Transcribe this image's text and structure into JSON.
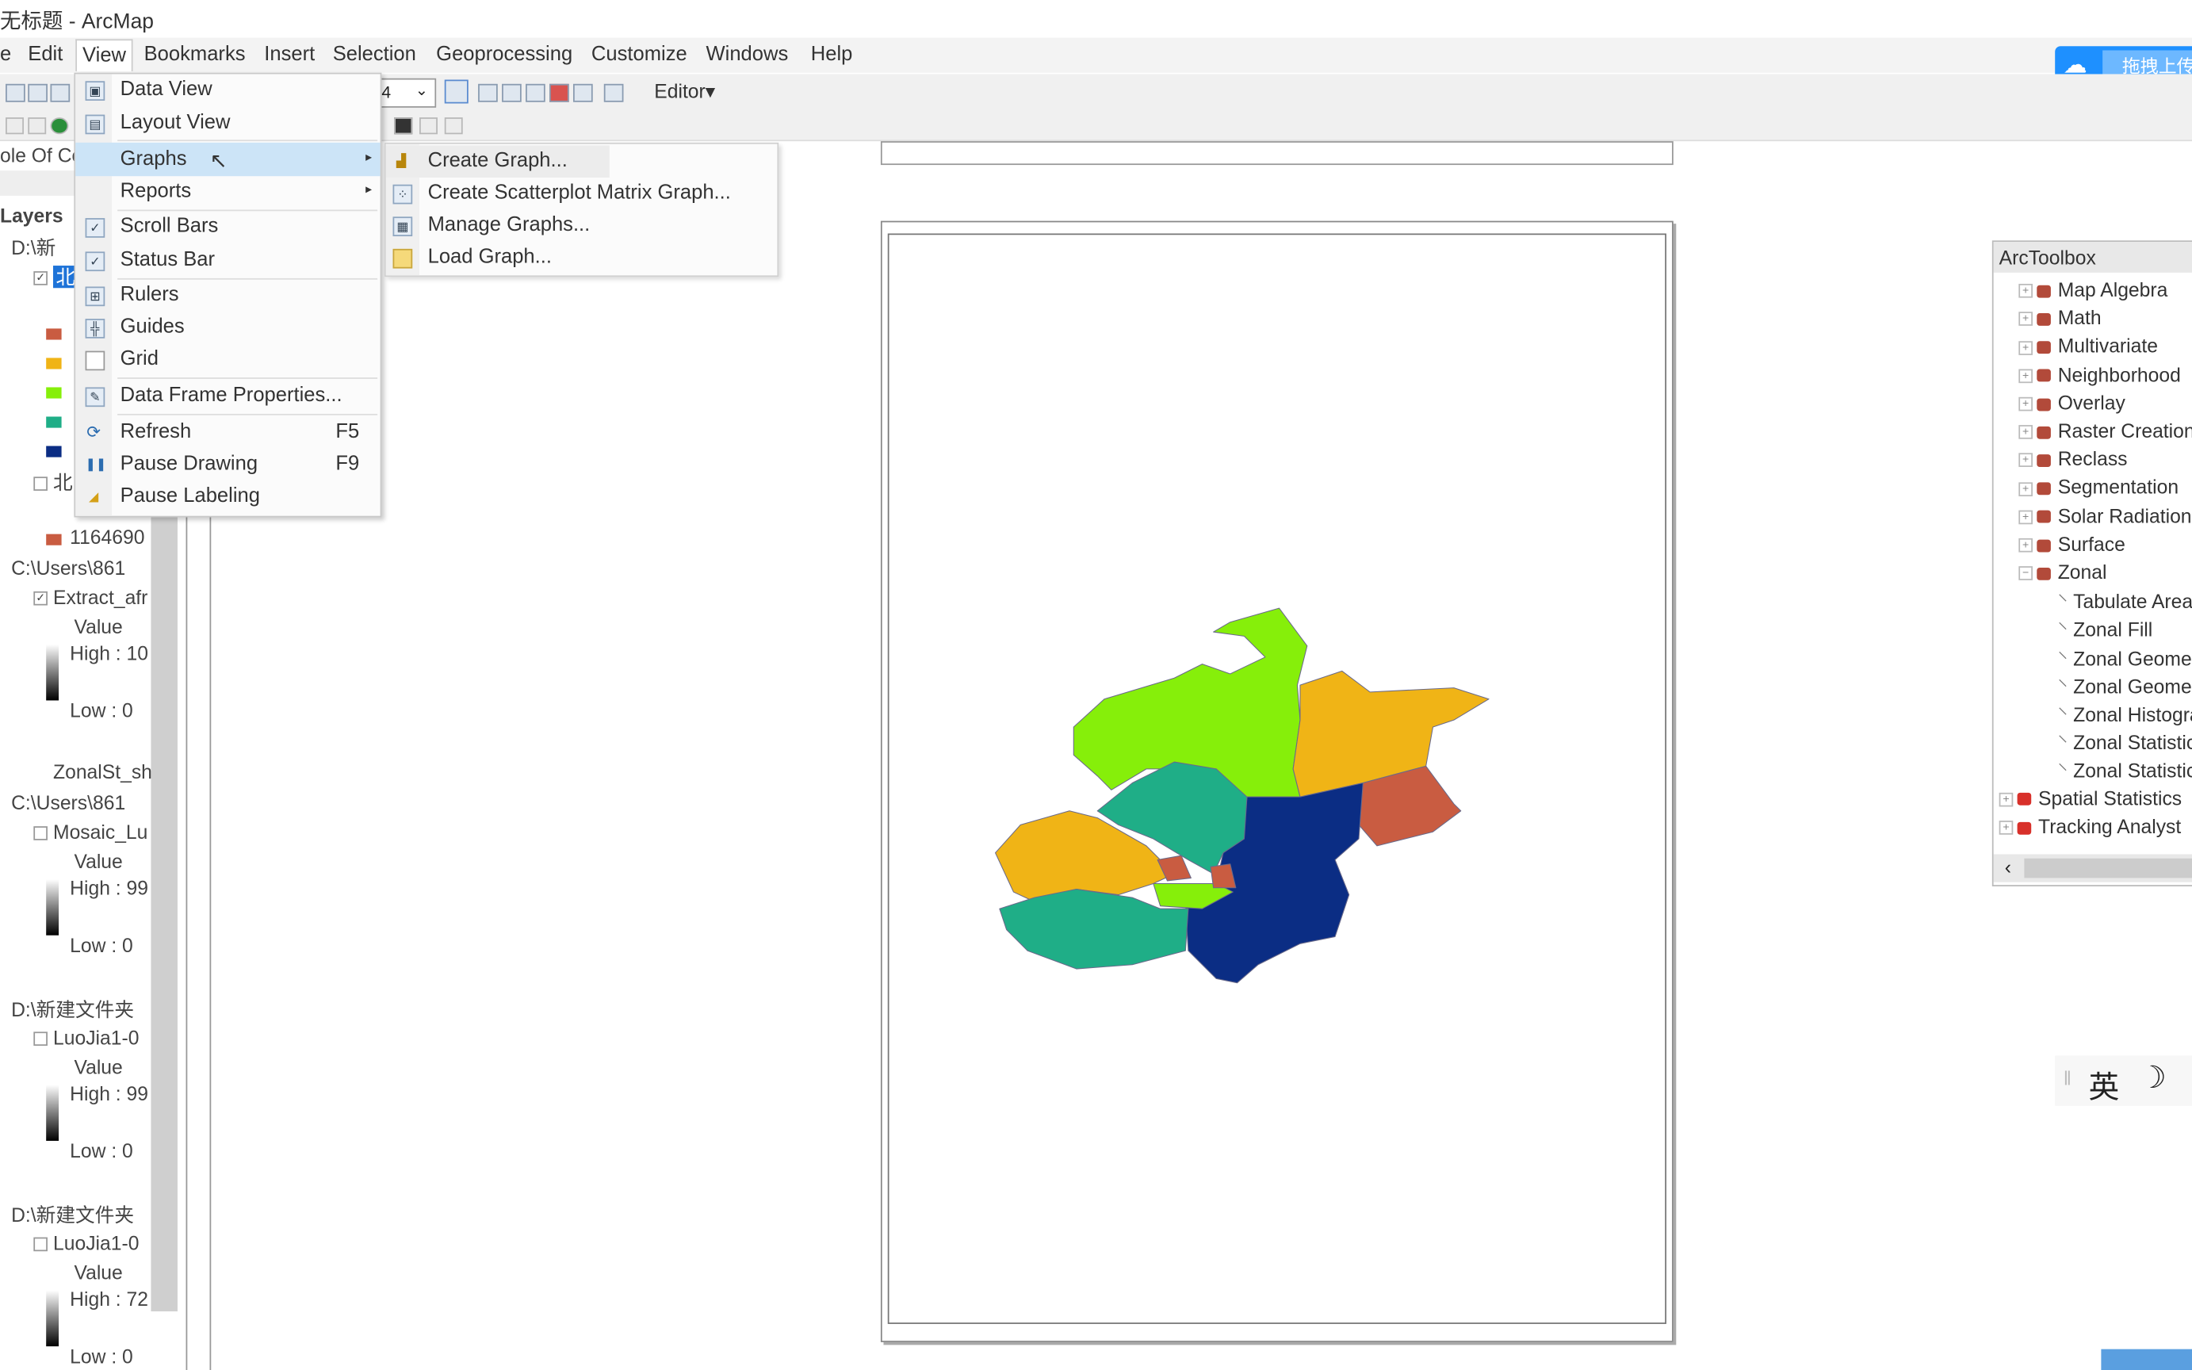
{
  "window": {
    "title": "无标题 - ArcMap"
  },
  "menubar": {
    "items": [
      "e",
      "Edit",
      "View",
      "Bookmarks",
      "Insert",
      "Selection",
      "Geoprocessing",
      "Customize",
      "Windows",
      "Help"
    ],
    "active": "View"
  },
  "toolbar": {
    "editor_label": "Editor▾",
    "scale_value": "4"
  },
  "cloud_button": {
    "label": "拖拽上传",
    "color": "#1e90ff"
  },
  "view_menu": {
    "items": [
      {
        "label": "Data View",
        "icon": "data-view-icon"
      },
      {
        "label": "Layout View",
        "icon": "layout-view-icon"
      },
      {
        "label": "Graphs",
        "submenu": true,
        "highlighted": true
      },
      {
        "label": "Reports",
        "submenu": true
      },
      {
        "label": "Scroll Bars",
        "checked": true
      },
      {
        "label": "Status Bar",
        "checked": true
      },
      {
        "label": "Rulers",
        "icon": "rulers-icon"
      },
      {
        "label": "Guides",
        "icon": "guides-icon"
      },
      {
        "label": "Grid",
        "icon": "grid-icon"
      },
      {
        "label": "Data Frame Properties...",
        "icon": "properties-icon"
      },
      {
        "label": "Refresh",
        "shortcut": "F5",
        "icon": "refresh-icon"
      },
      {
        "label": "Pause Drawing",
        "shortcut": "F9",
        "icon": "pause-icon"
      },
      {
        "label": "Pause Labeling",
        "icon": "labeling-icon"
      }
    ]
  },
  "graphs_submenu": {
    "items": [
      "Create Graph...",
      "Create Scatterplot Matrix Graph...",
      "Manage Graphs...",
      "Load Graph..."
    ]
  },
  "toc": {
    "header": "ole Of Co",
    "layers_label": "Layers",
    "rows": [
      "D:\\新",
      "北",
      "北",
      "1164690",
      "C:\\Users\\861",
      "Extract_afr",
      "Value",
      "High : 10",
      "Low : 0",
      "ZonalSt_sh",
      "C:\\Users\\861",
      "Mosaic_Lu",
      "Value",
      "High : 99",
      "Low : 0",
      "D:\\新建文件夹",
      "LuoJia1-0",
      "Value",
      "High : 99",
      "Low : 0",
      "D:\\新建文件夹",
      "LuoJia1-0",
      "Value",
      "High : 72",
      "Low : 0"
    ],
    "swatch_colors": [
      "#c95c41",
      "#f0b416",
      "#86ef0a",
      "#1fae87",
      "#0b2d84"
    ]
  },
  "map": {
    "colors": {
      "red": "#c95c41",
      "orange": "#f0b416",
      "lime": "#86ef0a",
      "teal": "#1fae87",
      "navy": "#0b2d84"
    }
  },
  "arctoolbox": {
    "title": "ArcToolbox",
    "toolsets": [
      "Map Algebra",
      "Math",
      "Multivariate",
      "Neighborhood",
      "Overlay",
      "Raster Creation",
      "Reclass",
      "Segmentation",
      "Solar Radiation",
      "Surface",
      "Zonal"
    ],
    "zonal_tools": [
      "Tabulate Area",
      "Zonal Fill",
      "Zonal Geometry",
      "Zonal Geometry",
      "Zonal Histogram",
      "Zonal Statistics",
      "Zonal Statistics"
    ],
    "toolboxes": [
      "Spatial Statistics",
      "Tracking Analyst"
    ]
  },
  "ime": {
    "lang": "英",
    "mode_icon": "moon-icon"
  }
}
